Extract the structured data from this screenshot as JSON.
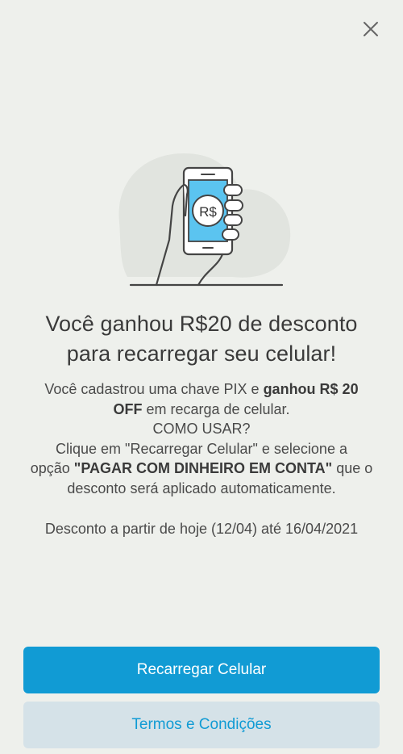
{
  "close": {
    "icon": "close-icon"
  },
  "illustration": {
    "currency_label": "R$",
    "icon": "hand-holding-phone-illustration"
  },
  "title": {
    "line1": "Você ganhou R$20 de desconto",
    "line2": "para recarregar seu celular!"
  },
  "body": {
    "p1_part1": "Você cadastrou uma chave PIX e ",
    "p1_bold1": "ganhou R$ 20",
    "p1_bold2": "OFF",
    "p1_part2": " em recarga de celular.",
    "how_to_use": "COMO USAR?",
    "p3_part1": "Clique em \"Recarregar Celular\" e selecione a",
    "p3_part2": "opção ",
    "p3_bold": "\"PAGAR COM DINHEIRO EM CONTA\"",
    "p3_part3": " que o",
    "p3_part4": "desconto será aplicado automaticamente."
  },
  "date_line": "Desconto a partir de hoje (12/04) até 16/04/2021",
  "buttons": {
    "primary": "Recarregar Celular",
    "secondary": "Termos e Condições"
  },
  "colors": {
    "background": "#eef0ec",
    "primary": "#119bd4",
    "secondary_bg": "#d5e2e8",
    "phone_screen": "#5bc4f0"
  }
}
